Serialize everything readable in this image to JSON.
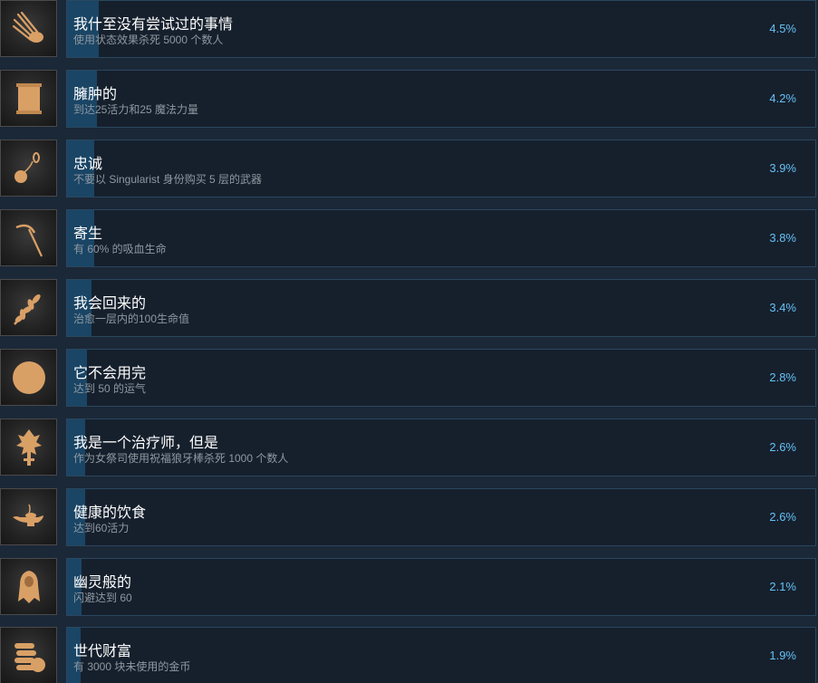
{
  "achievements": [
    {
      "title": "我什至没有尝试过的事情",
      "desc": "使用状态效果杀死 5000 个数人",
      "pct": "4.5%",
      "fill": 0.045,
      "icon": "claw-icon"
    },
    {
      "title": "臃肿的",
      "desc": "到达25活力和25 魔法力量",
      "pct": "4.2%",
      "fill": 0.042,
      "icon": "scroll-icon"
    },
    {
      "title": "忠诚",
      "desc": "不要以 Singularist 身份购买 5 层的武器",
      "pct": "3.9%",
      "fill": 0.039,
      "icon": "flail-icon"
    },
    {
      "title": "寄生",
      "desc": "有 60% 的吸血生命",
      "pct": "3.8%",
      "fill": 0.038,
      "icon": "scythe-icon"
    },
    {
      "title": "我会回来的",
      "desc": "治愈一层内的100生命值",
      "pct": "3.4%",
      "fill": 0.034,
      "icon": "wheat-icon"
    },
    {
      "title": "它不会用完",
      "desc": "达到 50 的运气",
      "pct": "2.8%",
      "fill": 0.028,
      "icon": "coin-icon"
    },
    {
      "title": "我是一个治疗师，但是",
      "desc": "作为女祭司使用祝福狼牙棒杀死 1000 个数人",
      "pct": "2.6%",
      "fill": 0.026,
      "icon": "mace-icon"
    },
    {
      "title": "健康的饮食",
      "desc": "达到60活力",
      "pct": "2.6%",
      "fill": 0.026,
      "icon": "lamp-icon"
    },
    {
      "title": "幽灵般的",
      "desc": "闪避达到 60",
      "pct": "2.1%",
      "fill": 0.021,
      "icon": "ghost-icon"
    },
    {
      "title": "世代财富",
      "desc": "有 3000 块未使用的金币",
      "pct": "1.9%",
      "fill": 0.019,
      "icon": "coins-icon"
    }
  ],
  "colors": {
    "icon": "#d9a066",
    "progress": "#1a4565",
    "pct": "#66c0f4"
  }
}
